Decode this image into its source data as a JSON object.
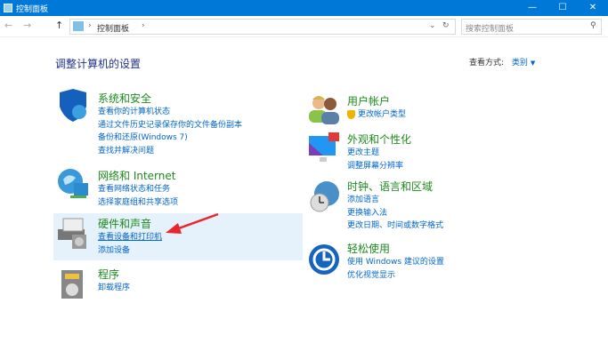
{
  "window": {
    "title": "控制面板",
    "min": "—",
    "max": "☐",
    "close": "✕"
  },
  "nav": {
    "back": "←",
    "forward": "→",
    "up": "↑",
    "breadcrumb": "控制面板",
    "sep": "›",
    "dropdown": "⌄",
    "refresh": "↻",
    "search_placeholder": "搜索控制面板",
    "search_icon": "⚲"
  },
  "heading": "调整计算机的设置",
  "view": {
    "label": "查看方式:",
    "value": "类别",
    "arrow": "▼"
  },
  "left": [
    {
      "title": "系统和安全",
      "links": [
        "查看你的计算机状态",
        "通过文件历史记录保存你的文件备份副本",
        "备份和还原(Windows 7)",
        "查找并解决问题"
      ]
    },
    {
      "title": "网络和 Internet",
      "links": [
        "查看网络状态和任务",
        "选择家庭组和共享选项"
      ]
    },
    {
      "title": "硬件和声音",
      "links": [
        "查看设备和打印机",
        "添加设备"
      ]
    },
    {
      "title": "程序",
      "links": [
        "卸载程序"
      ]
    }
  ],
  "right": [
    {
      "title": "用户帐户",
      "links": [
        "更改帐户类型"
      ]
    },
    {
      "title": "外观和个性化",
      "links": [
        "更改主题",
        "调整屏幕分辨率"
      ]
    },
    {
      "title": "时钟、语言和区域",
      "links": [
        "添加语言",
        "更换输入法",
        "更改日期、时间或数字格式"
      ]
    },
    {
      "title": "轻松使用",
      "links": [
        "使用 Windows 建议的设置",
        "优化视觉显示"
      ]
    }
  ],
  "colors": {
    "accent": "#0078d7",
    "title_green": "#1e8a1e",
    "link": "#0066cc",
    "highlight": "#e5f1fb",
    "arrow": "#e8262b"
  }
}
